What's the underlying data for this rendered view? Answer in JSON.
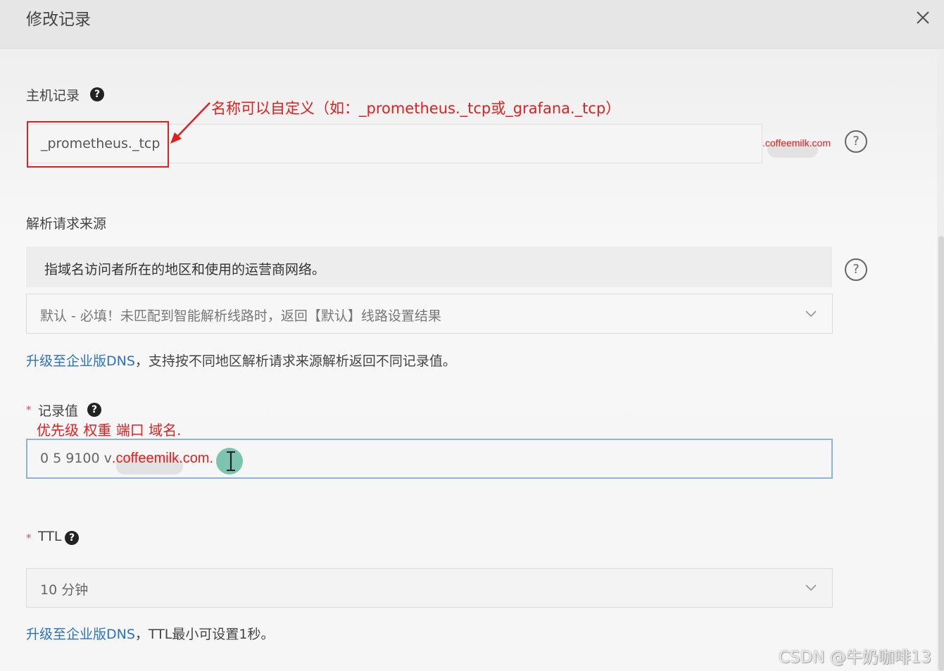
{
  "dialog": {
    "title": "修改记录",
    "close_icon": "close-icon"
  },
  "host": {
    "label": "主机记录",
    "value": "_prometheus._tcp",
    "suffix": ".coffeemilk.com",
    "annotation": "名称可以自定义（如：_prometheus._tcp或_grafana._tcp）"
  },
  "source": {
    "label": "解析请求来源",
    "description": "指域名访问者所在的地区和使用的运营商网络。",
    "select_value": "默认 - 必填！未匹配到智能解析线路时，返回【默认】线路设置结果",
    "upgrade_link": "升级至企业版DNS",
    "upgrade_text": "，支持按不同地区解析请求来源解析返回不同记录值。"
  },
  "record_value": {
    "required_mark": "*",
    "label": "记录值",
    "annotation": "优先级 权重 端口 域名.",
    "value_prefix": "0 5 9100 v",
    "value_domain": ".coffeemilk.com."
  },
  "ttl": {
    "required_mark": "*",
    "label": "TTL",
    "select_value": "10 分钟",
    "upgrade_link": "升级至企业版DNS",
    "upgrade_text": "，TTL最小可设置1秒。"
  },
  "watermark": "CSDN @牛奶咖啡13",
  "colors": {
    "annotation_red": "#e0201f",
    "link_blue": "#2b72c9",
    "focus_border": "#8fb3d6"
  }
}
